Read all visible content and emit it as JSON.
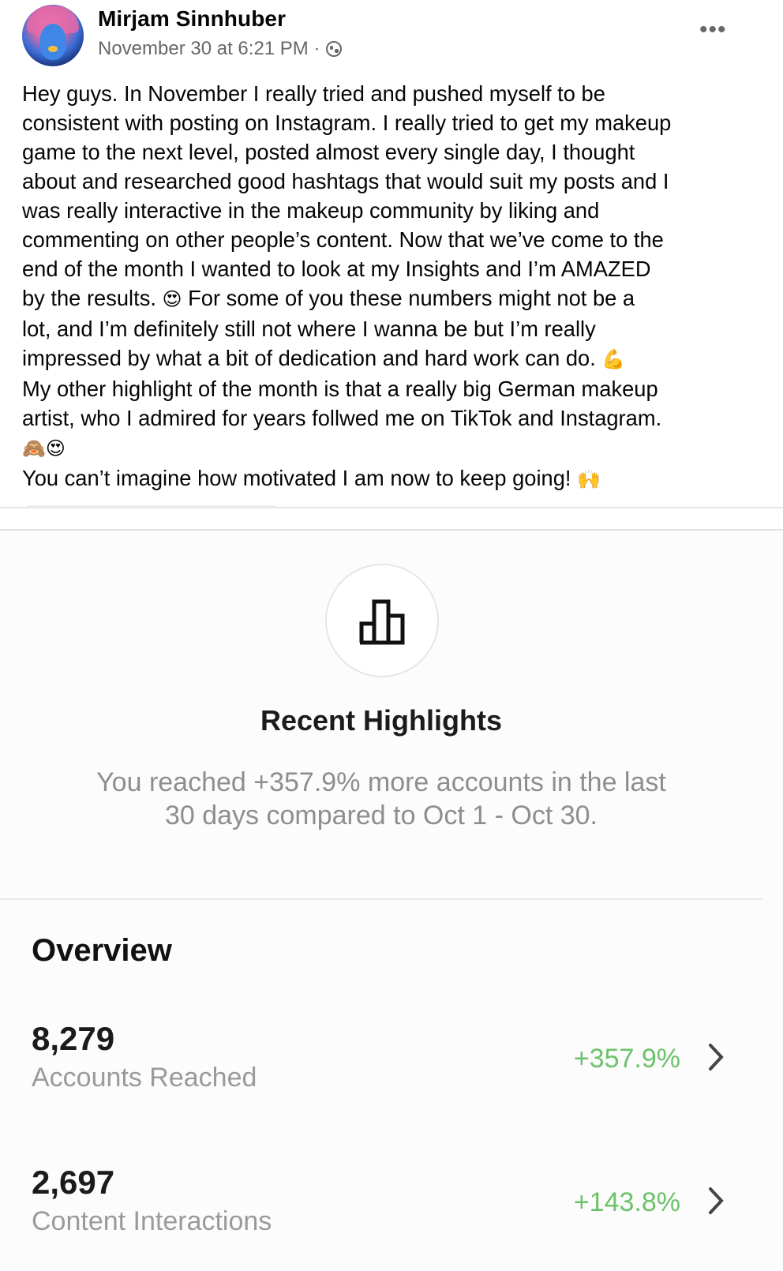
{
  "post": {
    "author": "Mirjam Sinnhuber",
    "timestamp": "November 30 at 6:21 PM ·",
    "more_icon": "•••",
    "privacy_icon": "globe-icon",
    "body": [
      "Hey guys. In November I really tried and pushed myself to be",
      "consistent with posting on Instagram. I really tried to get my makeup",
      "game to the next level, posted almost every single day, I thought",
      "about and researched good hashtags that would suit my posts and I",
      "was really interactive in the makeup community by liking and",
      "commenting on other people’s content. Now that we’ve come to the",
      "end of the month I wanted to look at my Insights and I’m AMAZED"
    ],
    "line8_text": "by the results. ",
    "line8_emoji": "😍",
    "line8_rest": " For some of you these numbers might not be a",
    "line9": "lot, and I’m definitely still not where I wanna be but I’m really",
    "line10_text": "impressed by what a bit of dedication and hard work can do. ",
    "line10_emoji": "💪",
    "line11": "My other highlight of the month is that a really big German makeup",
    "line12": "artist, who I admired for years follwed me on TikTok and Instagram.",
    "line13_emoji": "🙈😍",
    "line14_text": "You can’t imagine how motivated I am now to keep going! ",
    "line14_emoji": "🙌"
  },
  "insights": {
    "icon": "bar-chart-icon",
    "highlights_title": "Recent Highlights",
    "highlights_text": "You reached +357.9% more accounts in the last 30 days compared to Oct 1 - Oct 30.",
    "overview_title": "Overview",
    "metrics": [
      {
        "value": "8,279",
        "label": "Accounts Reached",
        "delta": "+357.9%"
      },
      {
        "value": "2,697",
        "label": "Content Interactions",
        "delta": "+143.8%"
      }
    ],
    "colors": {
      "positive": "#6cc26a",
      "muted": "#8e8e8e"
    }
  }
}
